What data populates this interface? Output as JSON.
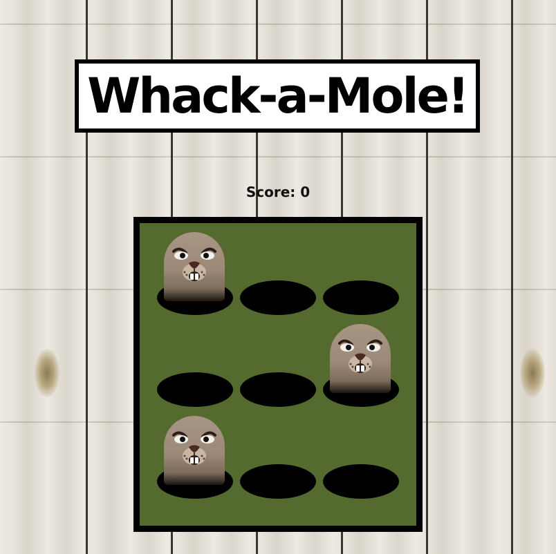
{
  "game": {
    "title": "Whack-a-Mole!",
    "score_label": "Score: 0",
    "score": 0
  },
  "board": {
    "rows": 3,
    "cols": 3,
    "holes": [
      {
        "row": 0,
        "col": 0,
        "mole": true
      },
      {
        "row": 0,
        "col": 1,
        "mole": false
      },
      {
        "row": 0,
        "col": 2,
        "mole": false
      },
      {
        "row": 1,
        "col": 0,
        "mole": false
      },
      {
        "row": 1,
        "col": 1,
        "mole": false
      },
      {
        "row": 1,
        "col": 2,
        "mole": true
      },
      {
        "row": 2,
        "col": 0,
        "mole": true
      },
      {
        "row": 2,
        "col": 1,
        "mole": false
      },
      {
        "row": 2,
        "col": 2,
        "mole": false
      }
    ]
  },
  "colors": {
    "board_bg": "#546a2f",
    "border": "#000000",
    "hole": "#000000",
    "mole_fur": "#9c8977"
  }
}
